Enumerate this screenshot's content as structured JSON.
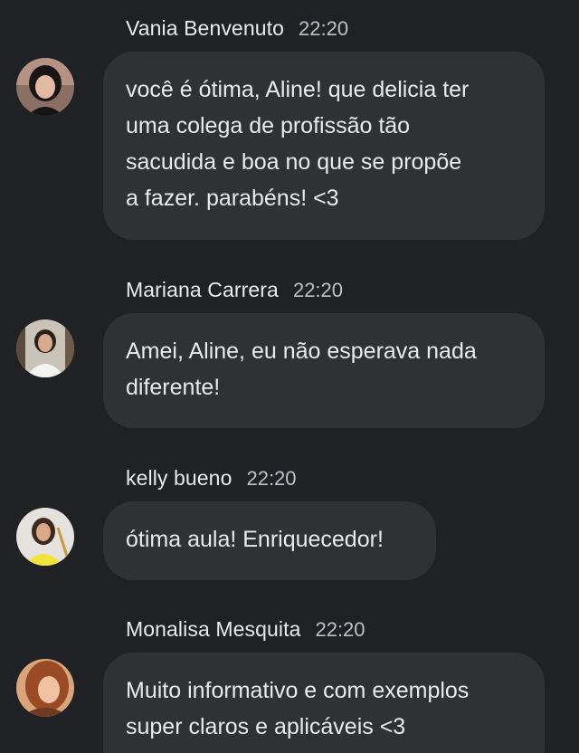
{
  "messages": [
    {
      "author": "Vania Benvenuto",
      "time": "22:20",
      "avatar": "avatar-photo-vania",
      "lines": [
        "você é ótima, Aline! que delicia ter",
        "uma colega de profissão tão",
        "sacudida e boa no que se propõe",
        "a fazer. parabéns! <3"
      ]
    },
    {
      "author": "Mariana Carrera",
      "time": "22:20",
      "avatar": "avatar-photo-mariana",
      "lines": [
        "Amei, Aline, eu não esperava nada",
        "diferente!"
      ]
    },
    {
      "author": "kelly bueno",
      "time": "22:20",
      "avatar": "avatar-photo-kelly",
      "lines": [
        "ótima aula! Enriquecedor!"
      ]
    },
    {
      "author": "Monalisa Mesquita",
      "time": "22:20",
      "avatar": "avatar-photo-monalisa",
      "lines": [
        "Muito informativo e com exemplos",
        "super claros e aplicáveis <3"
      ]
    }
  ],
  "colors": {
    "background": "#202124",
    "bubble": "#303134",
    "text_primary": "#e8eaed",
    "text_secondary": "#bdc1c6"
  }
}
